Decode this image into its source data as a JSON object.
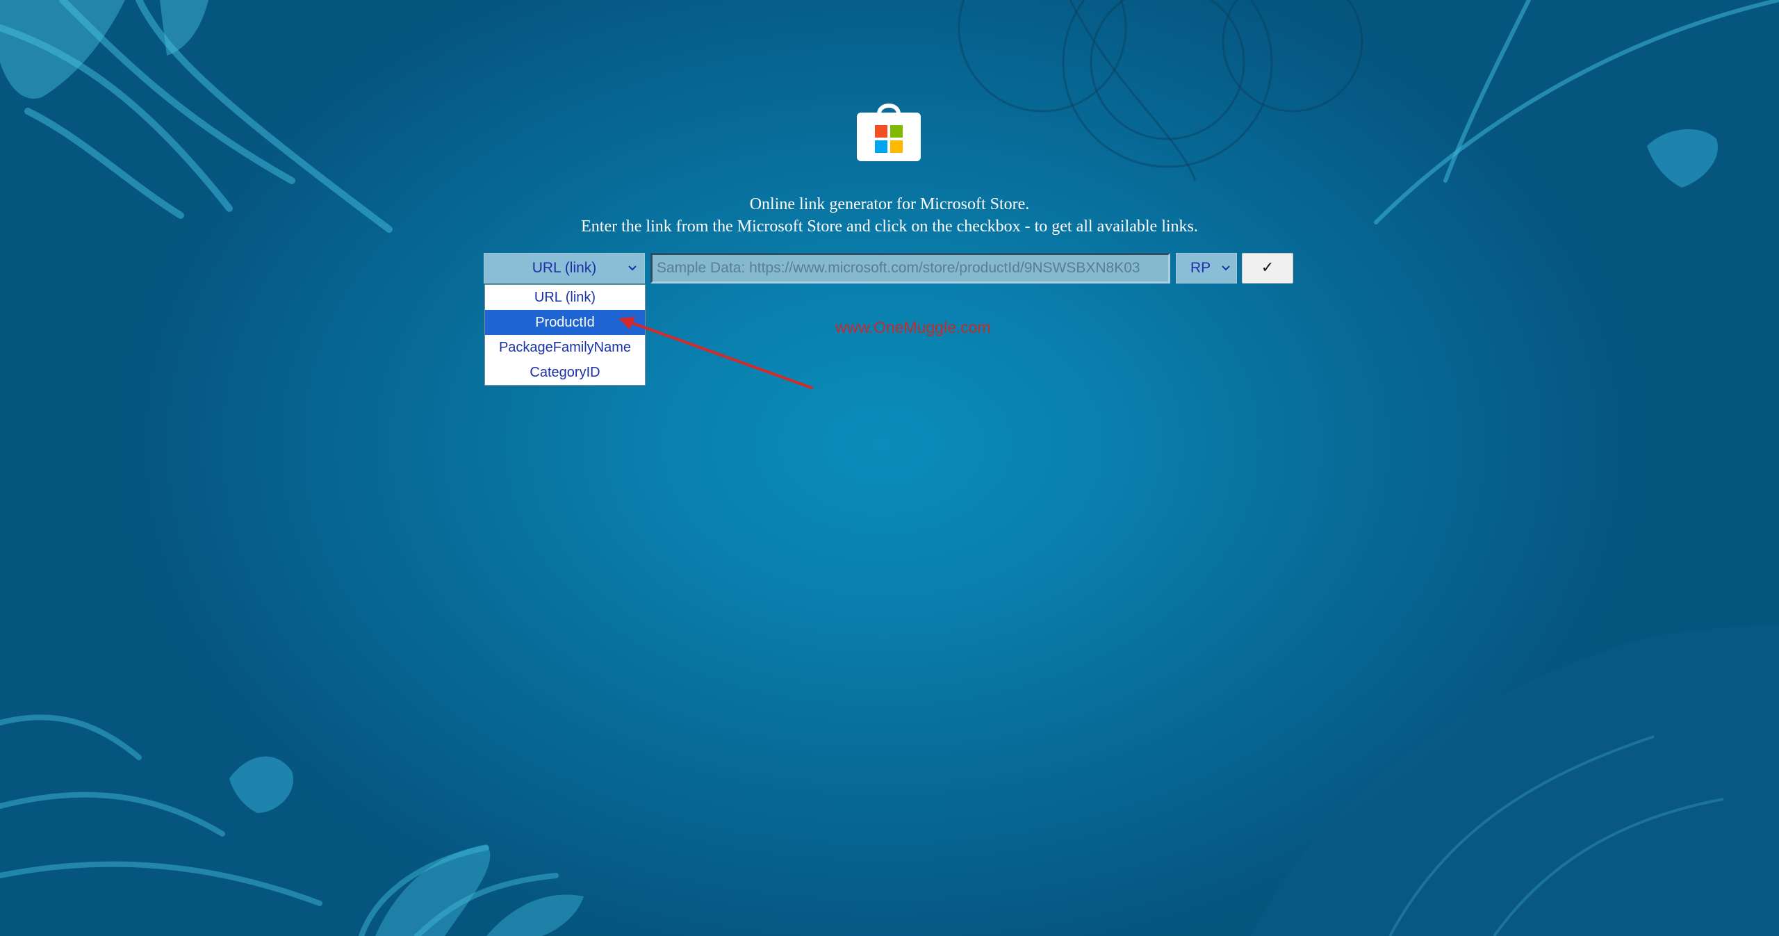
{
  "header": {
    "logo_icon": "microsoft-store-bag-icon",
    "line1": "Online link generator for Microsoft Store.",
    "line2": "Enter the link from the Microsoft Store and click on the checkbox - to get all available links."
  },
  "form": {
    "type_select": {
      "selected_label": "URL (link)",
      "options": [
        "URL (link)",
        "ProductId",
        "PackageFamilyName",
        "CategoryID"
      ],
      "highlighted_option": "ProductId"
    },
    "url_input": {
      "value": "",
      "placeholder": "Sample Data: https://www.microsoft.com/store/productId/9NSWSBXN8K03"
    },
    "ring_select": {
      "selected_label": "RP"
    },
    "submit": {
      "label": "✓",
      "icon": "checkmark-icon"
    }
  },
  "watermark": {
    "text": "www.OneMuggle.com"
  },
  "colors": {
    "background": "#0a7fae",
    "highlight": "#1e64d2",
    "option_text": "#1b2fa6",
    "watermark": "#c52b2b",
    "annotation_arrow": "#d62a2a"
  }
}
